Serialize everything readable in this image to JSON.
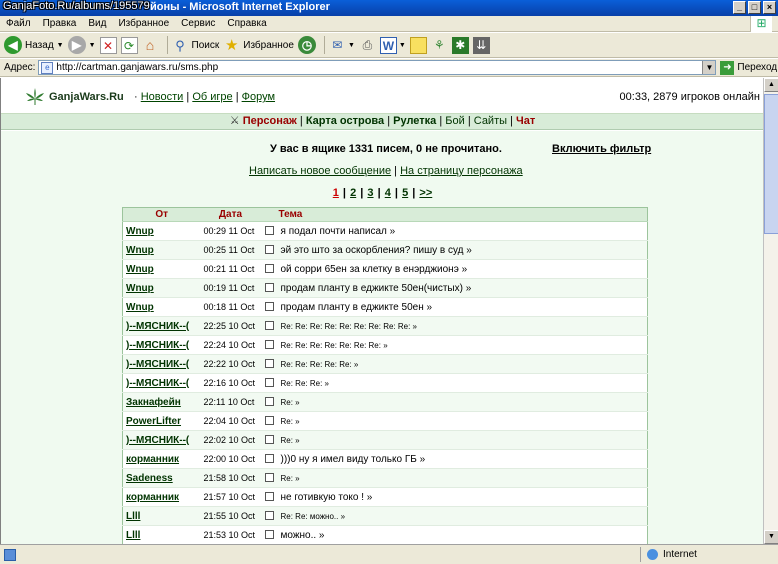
{
  "window": {
    "watermark": "GanjaFoto.Ru/albums/195579",
    "title": "йоны - Microsoft Internet Explorer",
    "buttons": [
      "_",
      "□",
      "×"
    ]
  },
  "menu": [
    "Файл",
    "Правка",
    "Вид",
    "Избранное",
    "Сервис",
    "Справка"
  ],
  "toolbar": {
    "back": "Назад",
    "search": "Поиск",
    "favorites": "Избранное"
  },
  "address": {
    "label": "Адрес:",
    "url": "http://cartman.ganjawars.ru/sms.php",
    "go": "Переход"
  },
  "site": {
    "brand": "GanjaWars.Ru",
    "brand_sep": " · ",
    "nav": [
      "Новости",
      "Об игре",
      "Форум"
    ],
    "online": "00:33, 2879 игроков онлайн"
  },
  "gamebar": {
    "items": [
      "Персонаж",
      "Карта острова",
      "Рулетка",
      "Бой",
      "Сайты",
      "Чат"
    ],
    "active": "Персонаж"
  },
  "inbox": {
    "summary": "У вас в ящике 1331 писем, 0 не прочитано.",
    "filter": "Включить фильтр",
    "compose": "Написать новое сообщение",
    "to_profile": "На страницу персонажа",
    "separator": " | "
  },
  "pager": {
    "pages": [
      "1",
      "2",
      "3",
      "4",
      "5",
      ">>"
    ],
    "current": "1"
  },
  "table": {
    "headers": {
      "from": "От",
      "date": "Дата",
      "subject": "Тема"
    },
    "rows": [
      {
        "from": "Wnup",
        "date": "00:29 11 Oct",
        "subject": "я подал почти написал »"
      },
      {
        "from": "Wnup",
        "date": "00:25 11 Oct",
        "subject": "эй это што за оскорбления? пишу в суд »"
      },
      {
        "from": "Wnup",
        "date": "00:21 11 Oct",
        "subject": "ой сорри 65ен за клетку в енэрджионэ »"
      },
      {
        "from": "Wnup",
        "date": "00:19 11 Oct",
        "subject": "продам планту в еджикте 50ен(чистых) »"
      },
      {
        "from": "Wnup",
        "date": "00:18 11 Oct",
        "subject": "продам планту в еджикте 50ен »"
      },
      {
        "from": ")--МЯСНИК--(",
        "date": "22:25 10 Oct",
        "subject": "Re: Re: Re: Re: Re: Re: Re: Re: Re:  »"
      },
      {
        "from": ")--МЯСНИК--(",
        "date": "22:24 10 Oct",
        "subject": "Re: Re: Re: Re: Re: Re: Re:  »"
      },
      {
        "from": ")--МЯСНИК--(",
        "date": "22:22 10 Oct",
        "subject": "Re: Re: Re: Re: Re:  »"
      },
      {
        "from": ")--МЯСНИК--(",
        "date": "22:16 10 Oct",
        "subject": "Re: Re: Re:  »"
      },
      {
        "from": "Закнафейн",
        "date": "22:11 10 Oct",
        "subject": "Re:  »"
      },
      {
        "from": "PowerLifter",
        "date": "22:04 10 Oct",
        "subject": "Re:  »"
      },
      {
        "from": ")--МЯСНИК--(",
        "date": "22:02 10 Oct",
        "subject": "Re:  »"
      },
      {
        "from": "корманник",
        "date": "22:00 10 Oct",
        "subject": ")))0 ну я имел виду только ГБ »"
      },
      {
        "from": "Sadeness",
        "date": "21:58 10 Oct",
        "subject": "Re:  »"
      },
      {
        "from": "корманник",
        "date": "21:57 10 Oct",
        "subject": "не готивкую токо ! »"
      },
      {
        "from": "Llll",
        "date": "21:55 10 Oct",
        "subject": "Re: Re: можно.. »"
      },
      {
        "from": "Llll",
        "date": "21:53 10 Oct",
        "subject": "можно.. »"
      }
    ]
  },
  "statusbar": {
    "zone": "Internet"
  },
  "colors": {
    "title_blue": "#0a5fd8",
    "page_bg": "#f0faf0",
    "bar_green": "#d8ecd8",
    "header_red": "#990000"
  }
}
